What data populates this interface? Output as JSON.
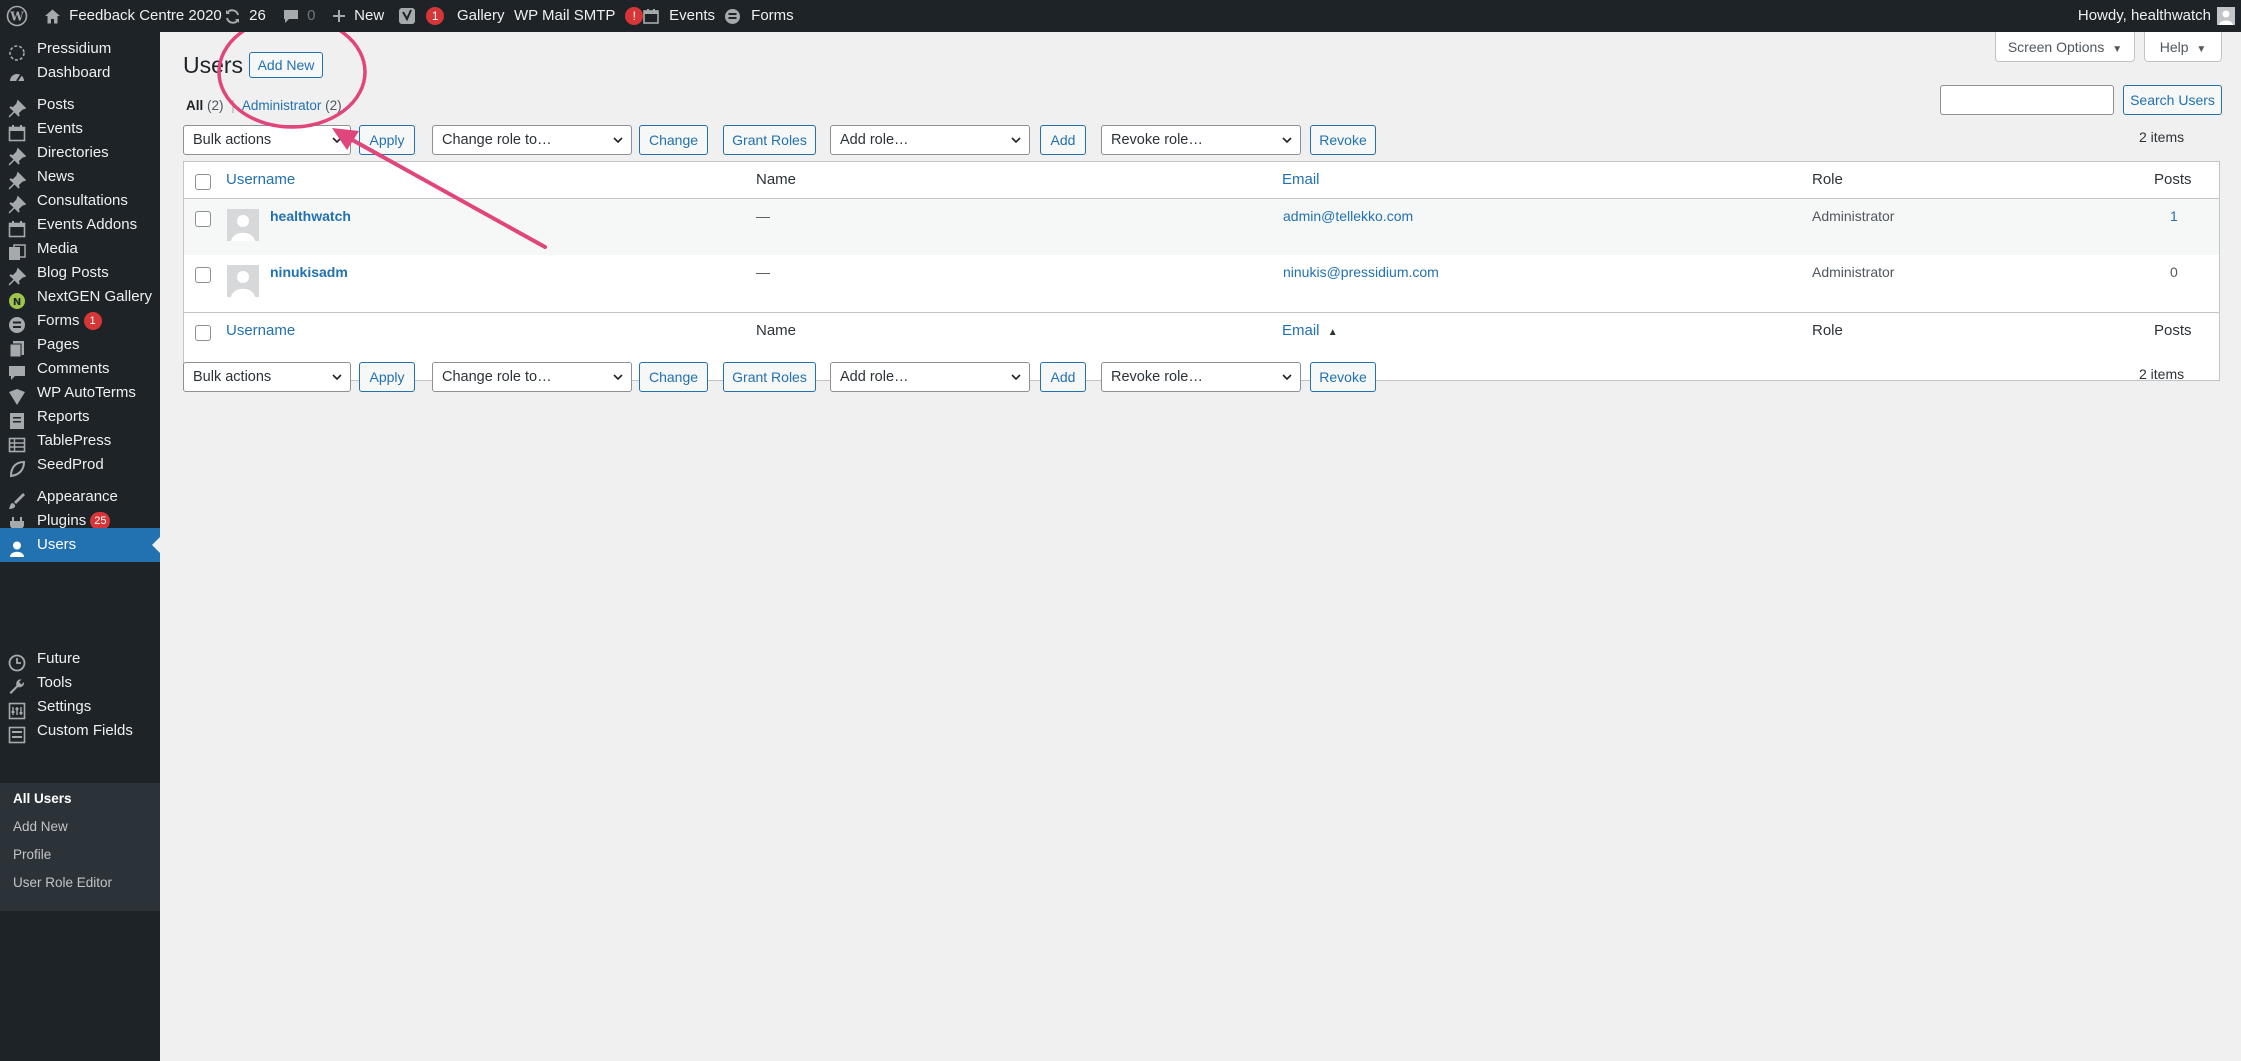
{
  "adminbar": {
    "site_name": "Feedback Centre 2020",
    "updates_count": "26",
    "comments_count": "0",
    "new_label": "New",
    "yoast_badge": "1",
    "gallery_label": "Gallery",
    "smtp_label": "WP Mail SMTP",
    "smtp_badge": "!",
    "events_label": "Events",
    "forms_label": "Forms",
    "howdy": "Howdy, healthwatch"
  },
  "sidebar": {
    "items": [
      {
        "label": "Pressidium",
        "icon": "pressidium-icon"
      },
      {
        "label": "Dashboard",
        "icon": "dashboard-icon"
      },
      {
        "label": "Posts",
        "icon": "pin-icon"
      },
      {
        "label": "Events",
        "icon": "calendar-icon"
      },
      {
        "label": "Directories",
        "icon": "pin-icon"
      },
      {
        "label": "News",
        "icon": "pin-icon"
      },
      {
        "label": "Consultations",
        "icon": "pin-icon"
      },
      {
        "label": "Events Addons",
        "icon": "calendar-icon"
      },
      {
        "label": "Media",
        "icon": "media-icon"
      },
      {
        "label": "Blog Posts",
        "icon": "pin-icon"
      },
      {
        "label": "NextGEN Gallery",
        "icon": "nextgen-icon"
      },
      {
        "label": "Forms",
        "icon": "forms-icon",
        "badge": "1"
      },
      {
        "label": "Pages",
        "icon": "pages-icon"
      },
      {
        "label": "Comments",
        "icon": "comment-icon"
      },
      {
        "label": "WP AutoTerms",
        "icon": "autoterms-icon"
      },
      {
        "label": "Reports",
        "icon": "reports-icon"
      },
      {
        "label": "TablePress",
        "icon": "table-icon"
      },
      {
        "label": "SeedProd",
        "icon": "seedprod-icon"
      },
      {
        "label": "Appearance",
        "icon": "brush-icon"
      },
      {
        "label": "Plugins",
        "icon": "plugin-icon",
        "badge": "25"
      },
      {
        "label": "Users",
        "icon": "user-icon"
      },
      {
        "label": "Future",
        "icon": "clock-icon"
      },
      {
        "label": "Tools",
        "icon": "wrench-icon"
      },
      {
        "label": "Settings",
        "icon": "settings-icon"
      },
      {
        "label": "Custom Fields",
        "icon": "fields-icon"
      }
    ],
    "submenu": [
      "All Users",
      "Add New",
      "Profile",
      "User Role Editor"
    ]
  },
  "page": {
    "title": "Users",
    "add_new": "Add New",
    "screen_options": "Screen Options",
    "help": "Help",
    "filter_all": "All",
    "filter_all_count": "(2)",
    "filter_sep": "|",
    "filter_admin": "Administrator",
    "filter_admin_count": "(2)",
    "search_placeholder": "",
    "search_button": "Search Users",
    "items_count": "2 items"
  },
  "toolbar": {
    "bulk_actions": "Bulk actions",
    "apply": "Apply",
    "change_role": "Change role to…",
    "change": "Change",
    "grant_roles": "Grant Roles",
    "add_role": "Add role…",
    "add": "Add",
    "revoke_role": "Revoke role…",
    "revoke": "Revoke"
  },
  "table": {
    "columns": [
      "Username",
      "Name",
      "Email",
      "Role",
      "Posts"
    ],
    "sort_indicator": "▲",
    "rows": [
      {
        "username": "healthwatch",
        "name": "—",
        "email": "admin@tellekko.com",
        "role": "Administrator",
        "posts": "1"
      },
      {
        "username": "ninukisadm",
        "name": "—",
        "email": "ninukis@pressidium.com",
        "role": "Administrator",
        "posts": "0"
      }
    ]
  },
  "colors": {
    "admin_bar": "#1d2327",
    "accent": "#2271b1",
    "badge": "#d63638",
    "annotation": "#e0457b"
  }
}
